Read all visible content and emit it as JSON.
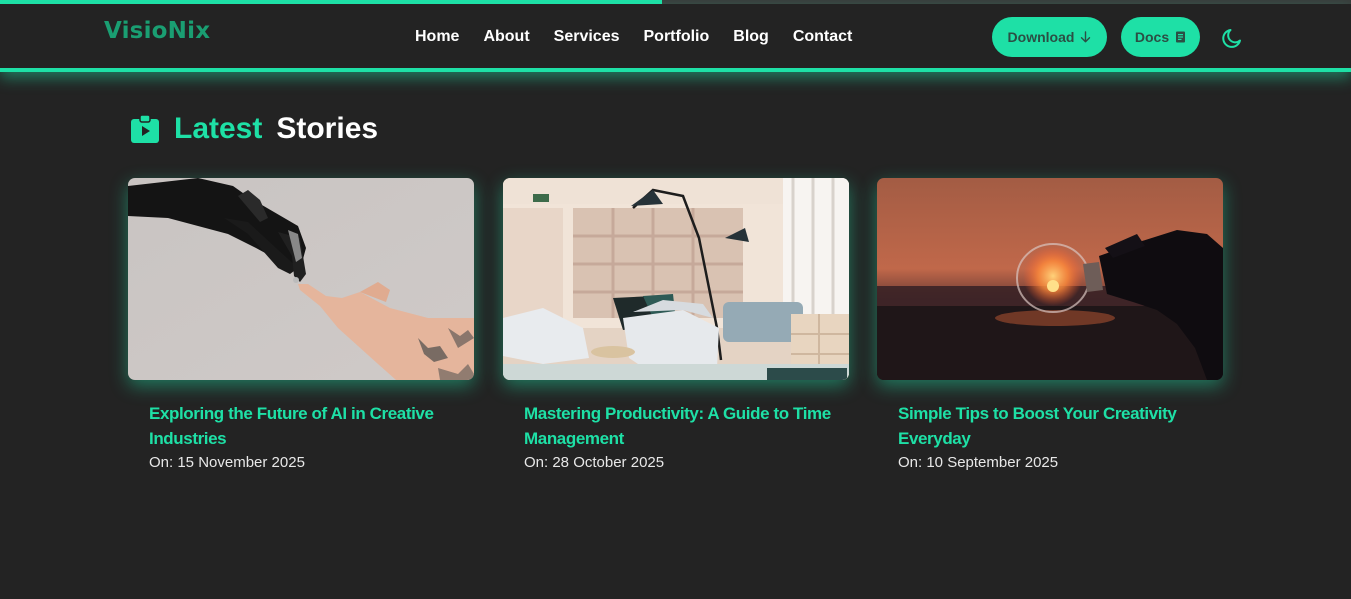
{
  "progress": {
    "fraction": 0.49,
    "color": "#1ee0a6"
  },
  "brand": {
    "part1": "Visio",
    "part2": "Nix",
    "accent": "#1ee0a6"
  },
  "nav": {
    "links": [
      "Home",
      "About",
      "Services",
      "Portfolio",
      "Blog",
      "Contact"
    ],
    "download_label": "Download",
    "download_icon": "arrow-down-icon",
    "docs_label": "Docs",
    "docs_icon": "document-icon",
    "theme_icon": "moon-icon"
  },
  "section": {
    "icon": "clipboard-icon",
    "title_highlight": "Latest",
    "title_rest": "Stories"
  },
  "stories": [
    {
      "title": "Exploring the Future of AI in Creative Industries",
      "date": "On: 15 November 2025",
      "image": "robot-hand-touching-human-hand"
    },
    {
      "title": "Mastering Productivity: A Guide to Time Management",
      "date": "On: 28 October 2025",
      "image": "modern-office-lounge"
    },
    {
      "title": "Simple Tips to Boost Your Creativity Everyday",
      "date": "On: 10 September 2025",
      "image": "hand-holding-lightbulb-at-sunset"
    }
  ]
}
